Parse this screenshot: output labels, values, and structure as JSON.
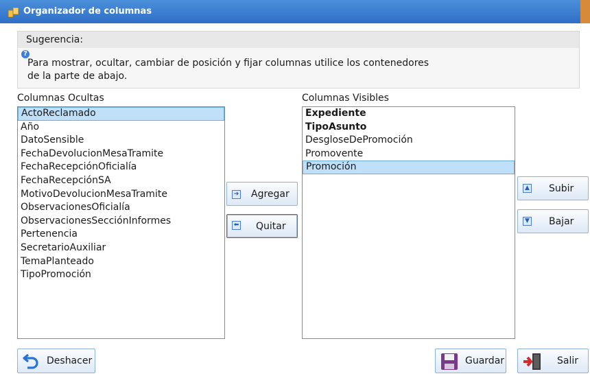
{
  "window": {
    "title": "Organizador de columnas"
  },
  "hint": {
    "header": "Sugerencia:",
    "line1": "Para mostrar, ocultar, cambiar de posición y fijar columnas utilice los contenedores",
    "line2": "de la parte de abajo."
  },
  "hidden_columns": {
    "label": "Columnas Ocultas",
    "items": [
      "ActoReclamado",
      "Año",
      "DatoSensible",
      "FechaDevolucionMesaTramite",
      "FechaRecepciónOficialía",
      "FechaRecepciónSA",
      "MotivoDevolucionMesaTramite",
      "ObservacionesOficialía",
      "ObservacionesSecciónInformes",
      "Pertenencia",
      "SecretarioAuxiliar",
      "TemaPlanteado",
      "TipoPromoción"
    ],
    "selected": "ActoReclamado"
  },
  "visible_columns": {
    "label": "Columnas Visibles",
    "items": [
      "Expediente",
      "TipoAsunto",
      "DesgloseDePromoción",
      "Promovente",
      "Promoción"
    ],
    "selected": "Promoción"
  },
  "buttons": {
    "add": "Agregar",
    "remove": "Quitar",
    "up": "Subir",
    "down": "Bajar",
    "undo": "Deshacer",
    "save": "Guardar",
    "exit": "Salir"
  }
}
